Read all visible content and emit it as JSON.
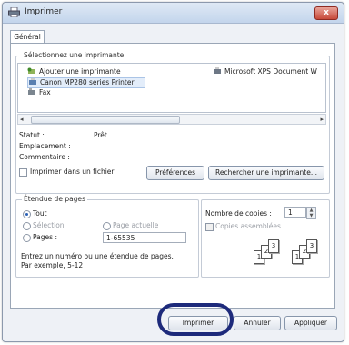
{
  "window": {
    "title": "Imprimer",
    "close_label": "x"
  },
  "tabs": [
    {
      "label": "Général"
    }
  ],
  "printer_group": {
    "legend": "Sélectionnez une imprimante",
    "items": [
      {
        "label": "Ajouter une imprimante",
        "icon": "add-printer-icon"
      },
      {
        "label": "Microsoft XPS Document W",
        "icon": "printer-icon"
      },
      {
        "label": "Canon MP280 series Printer",
        "icon": "printer-icon",
        "selected": true
      },
      {
        "label": "Fax",
        "icon": "fax-icon"
      }
    ]
  },
  "status": {
    "status_label": "Statut :",
    "status_value": "Prêt",
    "location_label": "Emplacement :",
    "comment_label": "Commentaire :",
    "print_to_file_label": "Imprimer dans un fichier",
    "preferences_label": "Préférences",
    "find_printer_label": "Rechercher une imprimante..."
  },
  "range": {
    "legend": "Étendue de pages",
    "all_label": "Tout",
    "selection_label": "Sélection",
    "current_page_label": "Page actuelle",
    "pages_label": "Pages :",
    "pages_value": "1-65535",
    "hint_line1": "Entrez un numéro ou une étendue de pages.",
    "hint_line2": "Par exemple, 5-12"
  },
  "copies": {
    "label": "Nombre de copies :",
    "value": "1",
    "collate_label": "Copies assemblées"
  },
  "footer": {
    "print_label": "Imprimer",
    "cancel_label": "Annuler",
    "apply_label": "Appliquer"
  },
  "colors": {
    "highlight": "#1d2a7b",
    "window_bg": "#eef1f6"
  }
}
